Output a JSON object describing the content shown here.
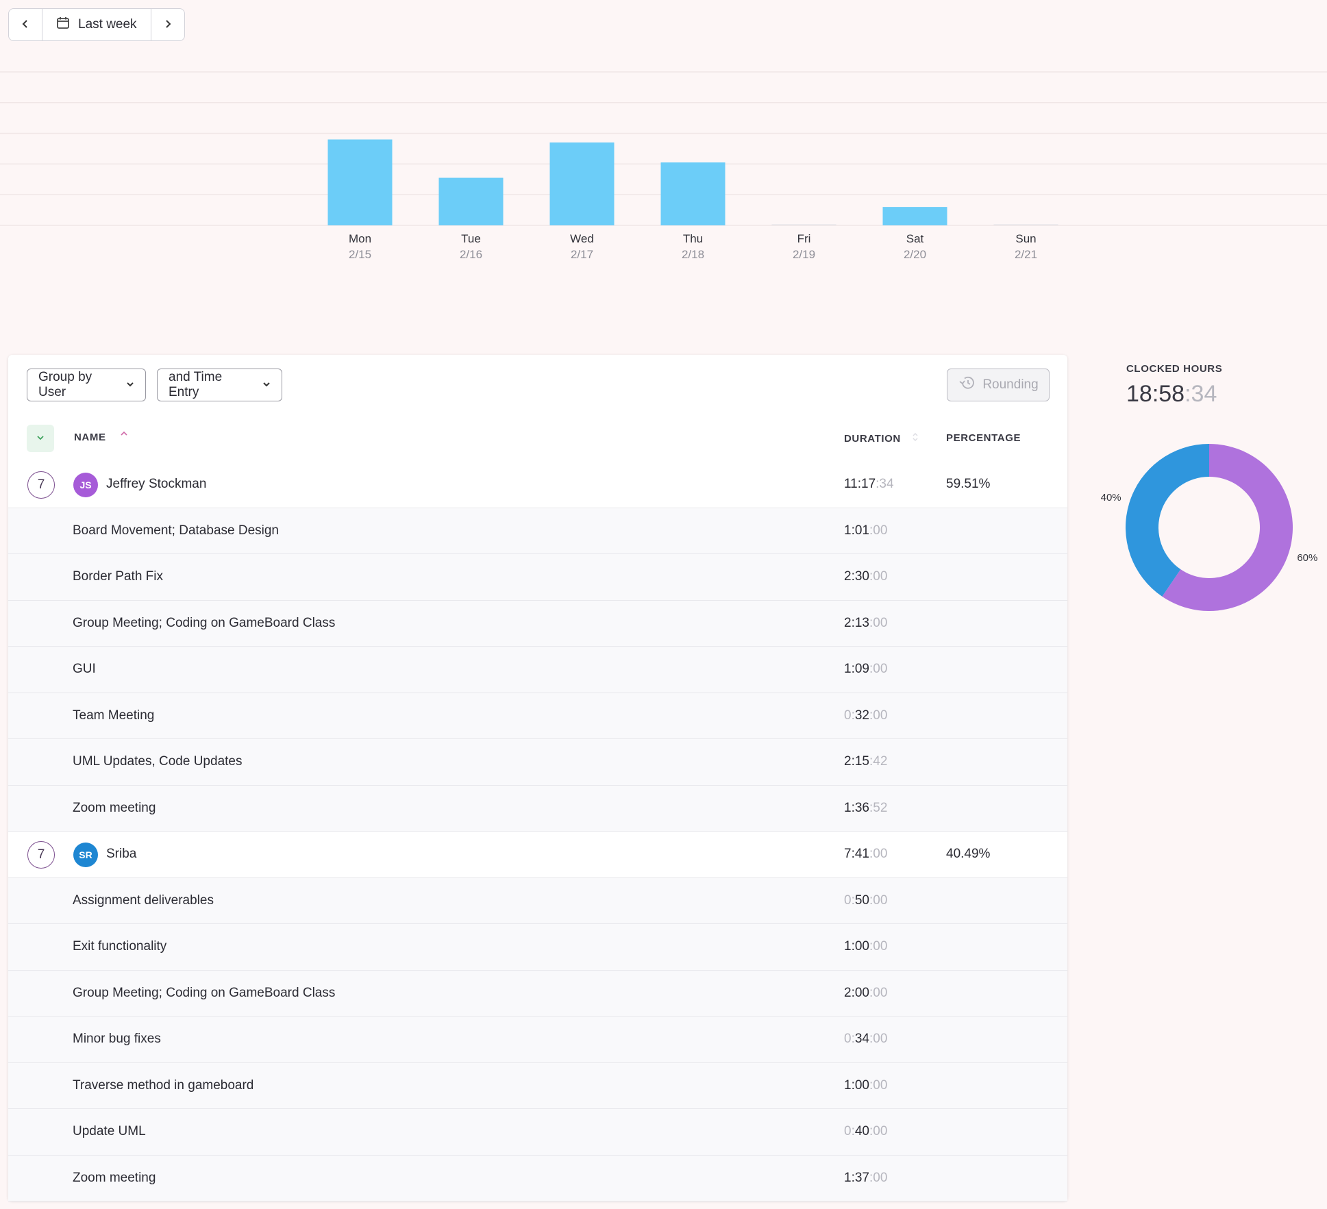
{
  "date_nav": {
    "prev_icon": "chevron-left-icon",
    "range_icon": "calendar-icon",
    "range_label": "Last week",
    "next_icon": "chevron-right-icon"
  },
  "chart_data": [
    {
      "type": "bar",
      "categories": [
        "Mon",
        "Tue",
        "Wed",
        "Thu",
        "Fri",
        "Sat",
        "Sun"
      ],
      "category_dates": [
        "2/15",
        "2/16",
        "2/17",
        "2/18",
        "2/19",
        "2/20",
        "2/21"
      ],
      "unit": "hours",
      "values": [
        5.6,
        3.1,
        5.4,
        4.1,
        0,
        1.2,
        0
      ],
      "ylim": [
        0,
        10
      ],
      "gridlines": [
        2,
        4,
        6,
        8,
        10
      ],
      "color": "#6ccdf8",
      "grid": true,
      "title": "",
      "xlabel": "",
      "ylabel": ""
    },
    {
      "type": "pie",
      "style": "donut",
      "slices": [
        {
          "value": 59.51,
          "label": "60%",
          "color": "#af72dd"
        },
        {
          "value": 40.49,
          "label": "40%",
          "color": "#2f96dd"
        }
      ]
    }
  ],
  "toolbar": {
    "group_by": "Group by User",
    "then_by": "and Time Entry",
    "rounding": "Rounding",
    "rounding_icon": "history-icon"
  },
  "table": {
    "headers": {
      "name": "NAME",
      "duration": "DURATION",
      "percentage": "PERCENTAGE"
    },
    "groups": [
      {
        "count": "7",
        "initials": "JS",
        "avatar_color": "#a65bd8",
        "name": "Jeffrey Stockman",
        "duration": {
          "main": "11:17",
          "sec": ":34"
        },
        "percentage": "59.51%",
        "entries": [
          {
            "name": "Board Movement; Database Design",
            "duration": {
              "lead": "",
              "main": "1:01",
              "sec": ":00"
            }
          },
          {
            "name": "Border Path Fix",
            "duration": {
              "lead": "",
              "main": "2:30",
              "sec": ":00"
            }
          },
          {
            "name": "Group Meeting; Coding on GameBoard Class",
            "duration": {
              "lead": "",
              "main": "2:13",
              "sec": ":00"
            }
          },
          {
            "name": "GUI",
            "duration": {
              "lead": "",
              "main": "1:09",
              "sec": ":00"
            }
          },
          {
            "name": "Team Meeting",
            "duration": {
              "lead": "0:",
              "main": "32",
              "sec": ":00"
            }
          },
          {
            "name": "UML Updates, Code Updates",
            "duration": {
              "lead": "",
              "main": "2:15",
              "sec": ":42"
            }
          },
          {
            "name": "Zoom meeting",
            "duration": {
              "lead": "",
              "main": "1:36",
              "sec": ":52"
            }
          }
        ]
      },
      {
        "count": "7",
        "initials": "SR",
        "avatar_color": "#1e86d2",
        "name": "Sriba",
        "duration": {
          "main": "7:41",
          "sec": ":00"
        },
        "percentage": "40.49%",
        "entries": [
          {
            "name": "Assignment deliverables",
            "duration": {
              "lead": "0:",
              "main": "50",
              "sec": ":00"
            }
          },
          {
            "name": "Exit functionality",
            "duration": {
              "lead": "",
              "main": "1:00",
              "sec": ":00"
            }
          },
          {
            "name": "Group Meeting; Coding on GameBoard Class",
            "duration": {
              "lead": "",
              "main": "2:00",
              "sec": ":00"
            }
          },
          {
            "name": "Minor bug fixes",
            "duration": {
              "lead": "0:",
              "main": "34",
              "sec": ":00"
            }
          },
          {
            "name": "Traverse method in gameboard",
            "duration": {
              "lead": "",
              "main": "1:00",
              "sec": ":00"
            }
          },
          {
            "name": "Update UML",
            "duration": {
              "lead": "0:",
              "main": "40",
              "sec": ":00"
            }
          },
          {
            "name": "Zoom meeting",
            "duration": {
              "lead": "",
              "main": "1:37",
              "sec": ":00"
            }
          }
        ]
      }
    ]
  },
  "summary": {
    "label": "CLOCKED HOURS",
    "value_main": "18:58",
    "value_sec": ":34"
  }
}
